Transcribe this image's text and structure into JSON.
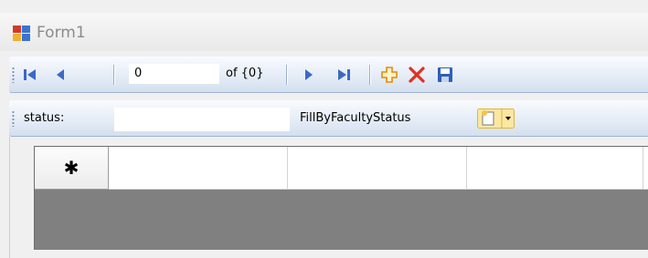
{
  "window": {
    "title": "Form1"
  },
  "binding_navigator": {
    "position_value": "0",
    "count_label": "of {0}",
    "icons": [
      "move-first-icon",
      "move-previous-icon",
      "move-next-icon",
      "move-last-icon",
      "add-new-icon",
      "delete-icon",
      "save-icon"
    ]
  },
  "fill_toolstrip": {
    "status_label": "status:",
    "status_value": "",
    "fill_button_label": "FillByFacultyStatus"
  },
  "grid": {
    "new_row_marker": "✱",
    "columns": [
      "",
      "",
      "",
      ""
    ]
  },
  "colors": {
    "nav_blue": "#3c68c8",
    "add_orange": "#f0a020",
    "delete_red": "#e03020",
    "toolbar_gradient_bottom": "#d4dfee",
    "grid_background": "#808080"
  }
}
